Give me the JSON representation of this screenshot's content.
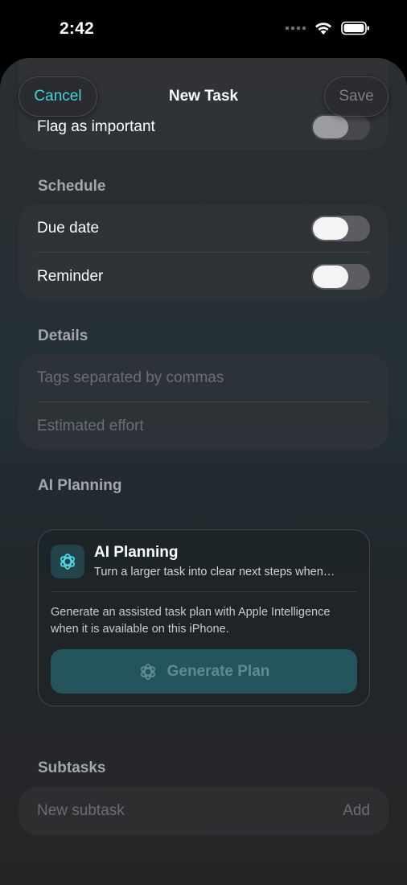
{
  "status_bar": {
    "time": "2:42",
    "icons": [
      "signal-dots-icon",
      "wifi-icon",
      "battery-icon"
    ]
  },
  "nav": {
    "cancel_label": "Cancel",
    "title": "New Task",
    "save_label": "Save"
  },
  "priority": {
    "flag_label": "Flag as important",
    "flag_on": false
  },
  "schedule": {
    "header": "Schedule",
    "due_date_label": "Due date",
    "due_date_on": false,
    "reminder_label": "Reminder",
    "reminder_on": false
  },
  "details": {
    "header": "Details",
    "tags_placeholder": "Tags separated by commas",
    "effort_placeholder": "Estimated effort"
  },
  "ai_planning": {
    "header": "AI Planning",
    "card_title": "AI Planning",
    "card_subtitle": "Turn a larger task into clear next steps when…",
    "description": "Generate an assisted task plan with Apple Intelligence when it is available on this iPhone.",
    "button_label": "Generate Plan",
    "icon": "sparkle-flower-icon"
  },
  "subtasks": {
    "header": "Subtasks",
    "placeholder": "New subtask",
    "add_label": "Add"
  },
  "colors": {
    "accent": "#3fd4df",
    "background": "#000000",
    "ai_button": "#24555c"
  }
}
